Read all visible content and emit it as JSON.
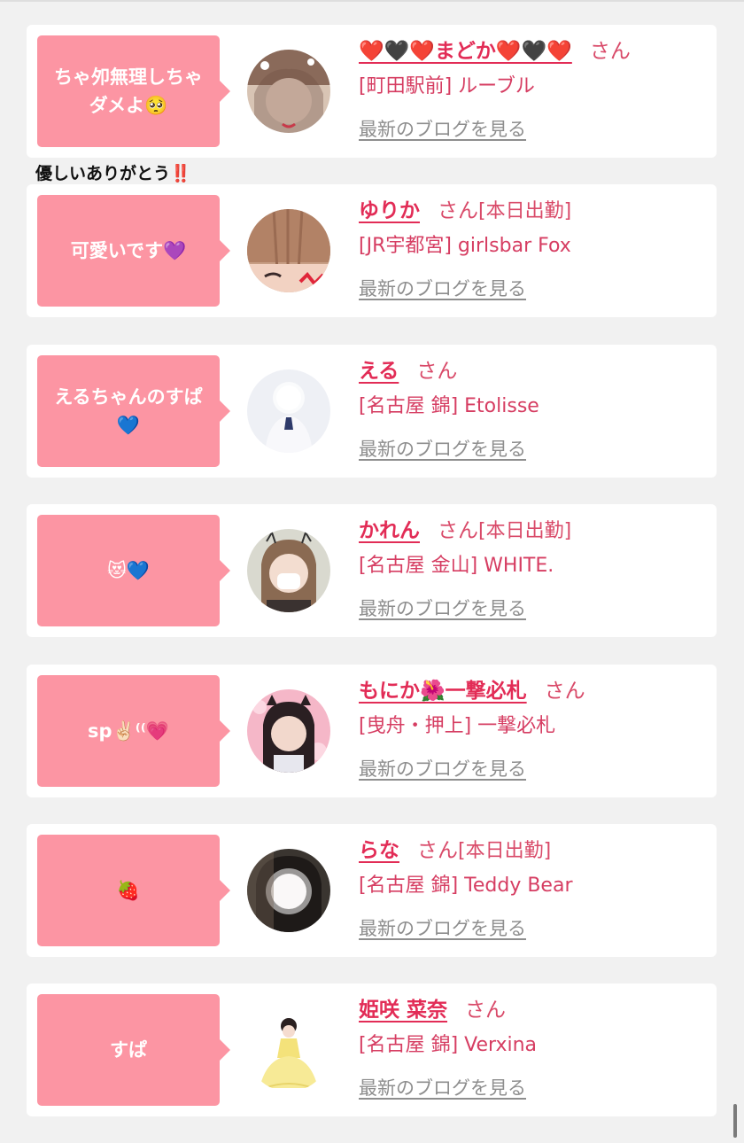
{
  "thanks_note": "優しいありがとう‼️",
  "blog_link_label": "最新のブログを見る",
  "cards": [
    {
      "comment": [
        "ちゃ夘無理しちゃ",
        "ダメよ🥺"
      ],
      "name": "❤️🖤❤️まどか❤️🖤❤️",
      "suffix": "さん",
      "status": "",
      "shop": "[町田駅前] ルーブル"
    },
    {
      "comment": [
        "可愛いです💜"
      ],
      "name": "ゆりか",
      "suffix": "さん",
      "status": "[本日出勤]",
      "shop": "[JR宇都宮] girlsbar Fox"
    },
    {
      "comment": [
        "えるちゃんのすぱ",
        "💙"
      ],
      "name": "える",
      "suffix": "さん",
      "status": "",
      "shop": "[名古屋 錦] Etolisse"
    },
    {
      "comment": [
        "😻💙"
      ],
      "name": "かれん",
      "suffix": "さん",
      "status": "[本日出勤]",
      "shop": "[名古屋 金山] WHITE."
    },
    {
      "comment": [
        "sp✌🏻⁽⁽💗"
      ],
      "name": "もにか🌺一撃必札",
      "suffix": "さん",
      "status": "",
      "shop": "[曳舟・押上] 一撃必札"
    },
    {
      "comment": [
        "🍓"
      ],
      "name": "らな",
      "suffix": "さん",
      "status": "[本日出勤]",
      "shop": "[名古屋 錦] Teddy Bear"
    },
    {
      "comment": [
        "すぱ"
      ],
      "name": "姫咲 菜奈",
      "suffix": "さん",
      "status": "",
      "shop": "[名古屋 錦] Verxina"
    }
  ]
}
